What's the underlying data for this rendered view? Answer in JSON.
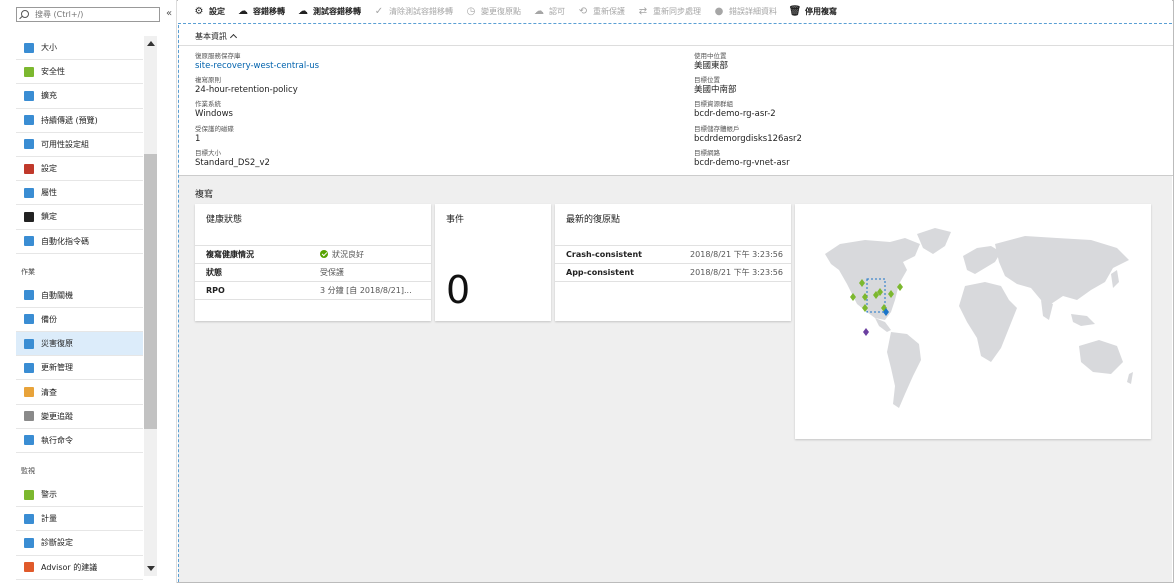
{
  "search": {
    "placeholder": "搜尋 (Ctrl+/)"
  },
  "sidebar": {
    "collapse_label": "«",
    "sections": [
      {
        "type": "item",
        "label": "大小",
        "icon": "monitor-icon",
        "color": "#3a8dd3"
      },
      {
        "type": "item",
        "label": "安全性",
        "icon": "shield-icon",
        "color": "#7cb82f"
      },
      {
        "type": "item",
        "label": "擴充",
        "icon": "extensions-icon",
        "color": "#3a8dd3"
      },
      {
        "type": "item",
        "label": "持續傳遞 (預覽)",
        "icon": "rocket-icon",
        "color": "#3a8dd3"
      },
      {
        "type": "item",
        "label": "可用性設定組",
        "icon": "availability-set-icon",
        "color": "#3a8dd3"
      },
      {
        "type": "item",
        "label": "設定",
        "icon": "toolbox-icon",
        "color": "#c0392b"
      },
      {
        "type": "item",
        "label": "屬性",
        "icon": "properties-icon",
        "color": "#3a8dd3"
      },
      {
        "type": "item",
        "label": "鎖定",
        "icon": "lock-icon",
        "color": "#222222"
      },
      {
        "type": "item",
        "label": "自動化指令碼",
        "icon": "script-icon",
        "color": "#3a8dd3"
      },
      {
        "type": "section",
        "label": "作業"
      },
      {
        "type": "item",
        "label": "自動關機",
        "icon": "clock-icon",
        "color": "#3a8dd3"
      },
      {
        "type": "item",
        "label": "備份",
        "icon": "cloud-backup-icon",
        "color": "#3a8dd3"
      },
      {
        "type": "item",
        "label": "災害復原",
        "icon": "cloud-recovery-icon",
        "color": "#3a8dd3",
        "active": true
      },
      {
        "type": "item",
        "label": "更新管理",
        "icon": "update-icon",
        "color": "#3a8dd3"
      },
      {
        "type": "item",
        "label": "清查",
        "icon": "inventory-icon",
        "color": "#e8a33a"
      },
      {
        "type": "item",
        "label": "變更追蹤",
        "icon": "change-tracking-icon",
        "color": "#8a8a8a"
      },
      {
        "type": "item",
        "label": "執行命令",
        "icon": "run-command-icon",
        "color": "#3a8dd3"
      },
      {
        "type": "section",
        "label": "監視"
      },
      {
        "type": "item",
        "label": "警示",
        "icon": "alert-icon",
        "color": "#7cb82f"
      },
      {
        "type": "item",
        "label": "計量",
        "icon": "metrics-icon",
        "color": "#3a8dd3"
      },
      {
        "type": "item",
        "label": "診斷設定",
        "icon": "diagnostics-icon",
        "color": "#3a8dd3"
      },
      {
        "type": "item",
        "label": "Advisor 的建議",
        "icon": "advisor-icon",
        "color": "#e05a2b"
      }
    ]
  },
  "toolbar": {
    "buttons": [
      {
        "label": "設定",
        "icon": "gear-icon",
        "glyph": "⚙",
        "enabled": true
      },
      {
        "label": "容錯移轉",
        "icon": "failover-icon",
        "glyph": "☁",
        "enabled": true
      },
      {
        "label": "測試容錯移轉",
        "icon": "test-failover-icon",
        "glyph": "☁",
        "enabled": true
      },
      {
        "label": "清除測試容錯移轉",
        "icon": "checkmark-icon",
        "glyph": "✓",
        "enabled": false
      },
      {
        "label": "變更復原點",
        "icon": "restore-point-icon",
        "glyph": "◷",
        "enabled": false
      },
      {
        "label": "認可",
        "icon": "commit-icon",
        "glyph": "☁",
        "enabled": false
      },
      {
        "label": "重新保護",
        "icon": "reprotect-icon",
        "glyph": "⟲",
        "enabled": false
      },
      {
        "label": "重新同步處理",
        "icon": "resync-icon",
        "glyph": "⇄",
        "enabled": false
      },
      {
        "label": "錯誤詳細資料",
        "icon": "error-icon",
        "glyph": "●",
        "enabled": false
      },
      {
        "label": "停用複寫",
        "icon": "trash-icon",
        "glyph": "🗑",
        "enabled": true
      }
    ]
  },
  "basic": {
    "title": "基本資訊",
    "left": [
      {
        "key": "復原服務保存庫",
        "value": "site-recovery-west-central-us",
        "link": true
      },
      {
        "key": "複寫原則",
        "value": "24-hour-retention-policy"
      },
      {
        "key": "作業系統",
        "value": "Windows"
      },
      {
        "key": "受保護的磁碟",
        "value": "1"
      },
      {
        "key": "目標大小",
        "value": "Standard_DS2_v2"
      }
    ],
    "right": [
      {
        "key": "使用中位置",
        "value": "美國東部"
      },
      {
        "key": "目標位置",
        "value": "美國中南部"
      },
      {
        "key": "目標資源群組",
        "value": "bcdr-demo-rg-asr-2"
      },
      {
        "key": "目標儲存體帳戶",
        "value": "bcdrdemorgdisks126asr2"
      },
      {
        "key": "目標網路",
        "value": "bcdr-demo-rg-vnet-asr"
      }
    ]
  },
  "replication": {
    "title": "複寫",
    "health": {
      "title": "健康狀態",
      "rows": [
        {
          "key": "複寫健康情況",
          "value": "狀況良好",
          "status_ok": true
        },
        {
          "key": "狀態",
          "value": "受保護"
        },
        {
          "key": "RPO",
          "value": "3 分鐘 [自 2018/8/21]..."
        }
      ]
    },
    "events": {
      "title": "事件",
      "count": "0"
    },
    "recovery_points": {
      "title": "最新的復原點",
      "rows": [
        {
          "key": "Crash-consistent",
          "value": "2018/8/21 下午 3:23:56"
        },
        {
          "key": "App-consistent",
          "value": "2018/8/21 下午 3:23:56"
        }
      ]
    }
  },
  "colors": {
    "accent": "#0062ad",
    "ok": "#57a300",
    "map_land": "#d8d9dc",
    "marker_green": "#7cb82f",
    "marker_blue": "#1a73c8",
    "marker_purple": "#6b3fa0"
  }
}
